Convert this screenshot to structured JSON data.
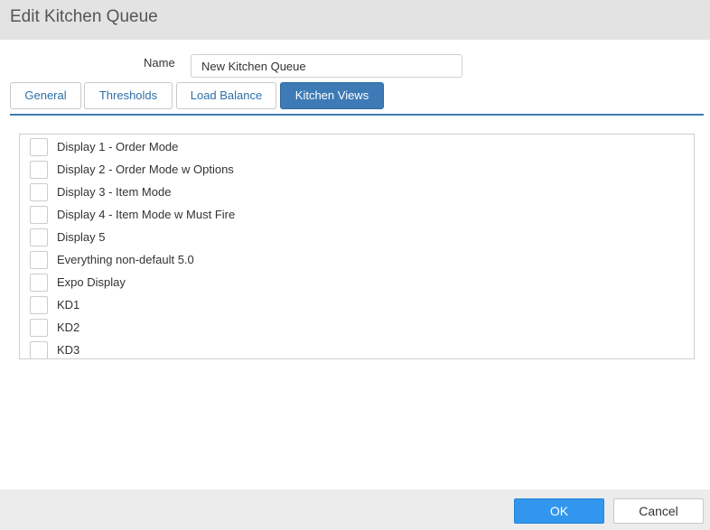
{
  "dialog": {
    "title": "Edit Kitchen Queue"
  },
  "form": {
    "name_label": "Name",
    "name_value": "New Kitchen Queue"
  },
  "tabs": [
    {
      "label": "General",
      "active": false
    },
    {
      "label": "Thresholds",
      "active": false
    },
    {
      "label": "Load Balance",
      "active": false
    },
    {
      "label": "Kitchen Views",
      "active": true
    }
  ],
  "kitchen_views": [
    {
      "label": "Display 1 - Order Mode",
      "checked": false
    },
    {
      "label": "Display 2 - Order Mode w Options",
      "checked": false
    },
    {
      "label": "Display 3 - Item Mode",
      "checked": false
    },
    {
      "label": "Display 4 - Item Mode w Must Fire",
      "checked": false
    },
    {
      "label": "Display 5",
      "checked": false
    },
    {
      "label": "Everything non-default 5.0",
      "checked": false
    },
    {
      "label": "Expo Display",
      "checked": false
    },
    {
      "label": "KD1",
      "checked": false
    },
    {
      "label": "KD2",
      "checked": false
    },
    {
      "label": "KD3",
      "checked": false
    }
  ],
  "footer": {
    "ok_label": "OK",
    "cancel_label": "Cancel"
  },
  "colors": {
    "accent": "#3e7bb6",
    "primary_button": "#3296ee",
    "title_bar": "#e3e3e3"
  }
}
